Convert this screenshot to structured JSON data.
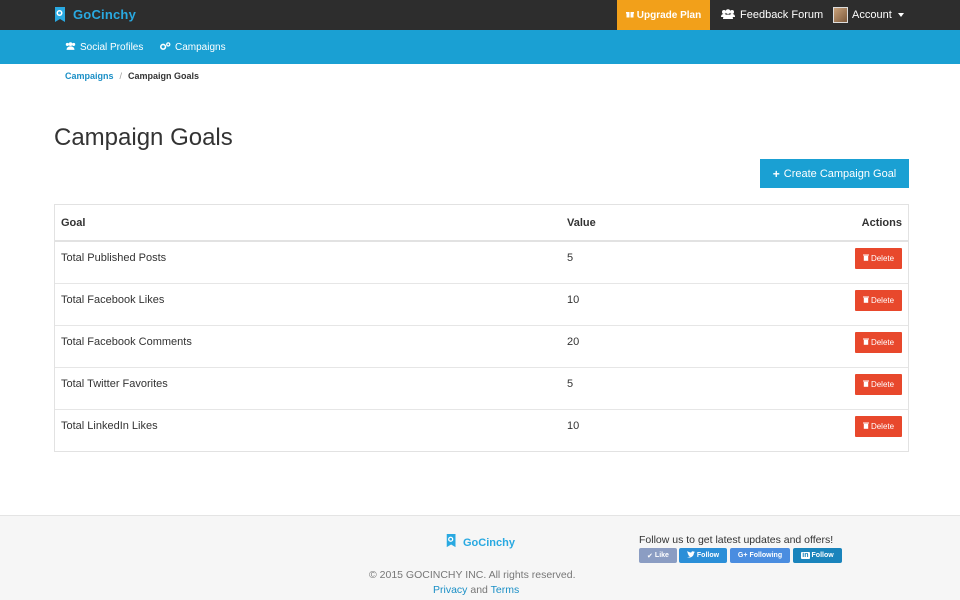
{
  "brand": {
    "name": "GoCinchy",
    "color": "#29a9e1"
  },
  "topbar": {
    "upgrade_label": "Upgrade Plan",
    "feedback_label": "Feedback Forum",
    "account_label": "Account"
  },
  "subnav": {
    "social_profiles": "Social Profiles",
    "campaigns": "Campaigns"
  },
  "breadcrumb": {
    "parent": "Campaigns",
    "separator": "/",
    "current": "Campaign Goals"
  },
  "page": {
    "title": "Campaign Goals",
    "create_button": "Create Campaign Goal"
  },
  "table": {
    "headers": {
      "goal": "Goal",
      "value": "Value",
      "actions": "Actions"
    },
    "rows": [
      {
        "goal": "Total Published Posts",
        "value": "5",
        "action": "Delete"
      },
      {
        "goal": "Total Facebook Likes",
        "value": "10",
        "action": "Delete"
      },
      {
        "goal": "Total Facebook Comments",
        "value": "20",
        "action": "Delete"
      },
      {
        "goal": "Total Twitter Favorites",
        "value": "5",
        "action": "Delete"
      },
      {
        "goal": "Total LinkedIn Likes",
        "value": "10",
        "action": "Delete"
      }
    ]
  },
  "footer": {
    "brand": "GoCinchy",
    "copyright": "© 2015 GOCINCHY INC. All rights reserved.",
    "privacy": "Privacy",
    "and": "and",
    "terms": "Terms",
    "follow_text": "Follow us to get latest updates and offers!",
    "social": {
      "facebook": "Like",
      "twitter": "Follow",
      "google": "Following",
      "linkedin": "Follow"
    }
  },
  "colors": {
    "topbar": "#2d2d2d",
    "subnav": "#1aa0d3",
    "upgrade": "#f2a01a",
    "delete": "#e8482c",
    "primary_button": "#1aa0d3"
  },
  "icons": [
    "gocinchy-logo-icon",
    "gift-icon",
    "users-icon",
    "cogs-icon",
    "plus-icon",
    "trash-icon",
    "check-icon",
    "twitter-icon",
    "google-plus-icon",
    "linkedin-icon"
  ]
}
